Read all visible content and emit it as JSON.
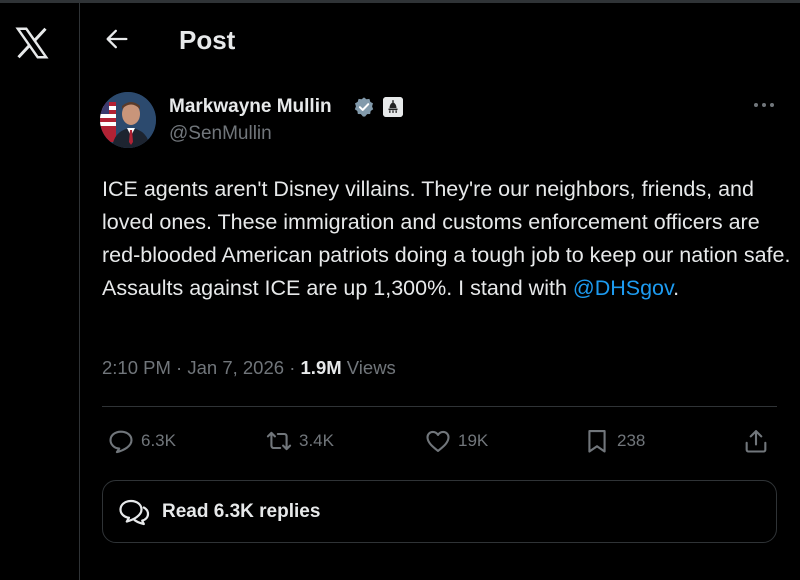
{
  "app": {
    "logo_icon": "x-logo-icon"
  },
  "header": {
    "title": "Post",
    "back_icon": "arrow-left-icon"
  },
  "author": {
    "name": "Markwayne Mullin",
    "handle": "@SenMullin",
    "verified_icon": "verified-badge-icon",
    "affiliation_icon": "government-affiliation-icon"
  },
  "tweet": {
    "text_before_mention": "ICE agents aren't Disney villains. They're our neighbors, friends, and loved ones. These immigration and customs enforcement officers are red-blooded American patriots doing a tough job to keep our nation safe. Assaults against ICE are up 1,300%. I stand with ",
    "mention": "@DHSgov",
    "text_after_mention": "."
  },
  "meta": {
    "time": "2:10 PM",
    "separator": "·",
    "date": "Jan 7, 2026",
    "views_count": "1.9M",
    "views_label": "Views"
  },
  "actions": {
    "replies": "6.3K",
    "reposts": "3.4K",
    "likes": "19K",
    "bookmarks": "238"
  },
  "read_replies": {
    "label": "Read 6.3K replies"
  },
  "colors": {
    "background": "#000000",
    "text": "#e7e9ea",
    "muted": "#71767b",
    "accent": "#1d9bf0",
    "border": "#2f3336"
  }
}
